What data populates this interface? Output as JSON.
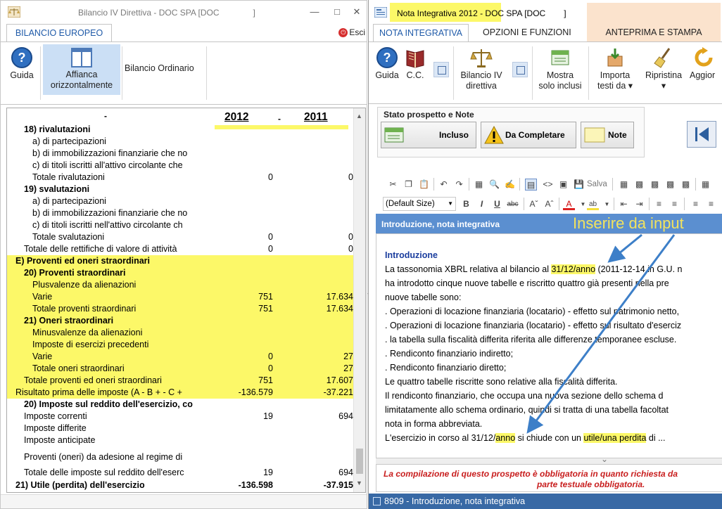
{
  "left_window": {
    "title": "Bilancio IV Direttiva - DOC SPA [DOC",
    "title_suffix": "]",
    "tab_label": "BILANCIO EUROPEO",
    "exit_label": "Esci",
    "ribbon": {
      "guida": "Guida",
      "affianca_line1": "Affianca",
      "affianca_line2": "orizzontalmente",
      "bilancio_ordinario": "Bilancio Ordinario"
    },
    "years": [
      "2012",
      "2011"
    ],
    "rows": [
      {
        "label": "18) rivalutazioni",
        "v1": "",
        "v2": ""
      },
      {
        "label": "a) di partecipazioni",
        "v1": "",
        "v2": ""
      },
      {
        "label": "b) di immobilizzazioni finanziarie che no",
        "v1": "",
        "v2": ""
      },
      {
        "label": "c) di titoli iscritti all'attivo circolante che",
        "v1": "",
        "v2": ""
      },
      {
        "label": "Totale rivalutazioni",
        "v1": "0",
        "v2": "0"
      },
      {
        "label": "19) svalutazioni",
        "v1": "",
        "v2": ""
      },
      {
        "label": "a) di partecipazioni",
        "v1": "",
        "v2": ""
      },
      {
        "label": "b) di immobilizzazioni finanziarie che no",
        "v1": "",
        "v2": ""
      },
      {
        "label": "c) di titoli iscritti nell'attivo circolante ch",
        "v1": "",
        "v2": ""
      },
      {
        "label": "Totale svalutazioni",
        "v1": "0",
        "v2": "0"
      },
      {
        "label": "Totale delle rettifiche di valore di attività",
        "v1": "0",
        "v2": "0"
      },
      {
        "label": "E) Proventi ed oneri straordinari",
        "v1": "",
        "v2": ""
      },
      {
        "label": "20) Proventi straordinari",
        "v1": "",
        "v2": ""
      },
      {
        "label": "Plusvalenze da alienazioni",
        "v1": "",
        "v2": ""
      },
      {
        "label": "Varie",
        "v1": "751",
        "v2": "17.634"
      },
      {
        "label": "Totale proventi straordinari",
        "v1": "751",
        "v2": "17.634"
      },
      {
        "label": "21) Oneri straordinari",
        "v1": "",
        "v2": ""
      },
      {
        "label": "Minusvalenze da alienazioni",
        "v1": "",
        "v2": ""
      },
      {
        "label": "Imposte di esercizi precedenti",
        "v1": "",
        "v2": ""
      },
      {
        "label": "Varie",
        "v1": "0",
        "v2": "27"
      },
      {
        "label": "Totale oneri straordinari",
        "v1": "0",
        "v2": "27"
      },
      {
        "label": "Totale proventi ed oneri straordinari",
        "v1": "751",
        "v2": "17.607"
      },
      {
        "label": "Risultato prima delle imposte (A - B + - C +",
        "v1": "-136.579",
        "v2": "-37.221"
      },
      {
        "label": "20) Imposte sul reddito dell'esercizio, co",
        "v1": "",
        "v2": ""
      },
      {
        "label": "Imposte correnti",
        "v1": "19",
        "v2": "694"
      },
      {
        "label": "Imposte differite",
        "v1": "",
        "v2": ""
      },
      {
        "label": "Imposte anticipate",
        "v1": "",
        "v2": ""
      },
      {
        "label": "Proventi (oneri) da adesione al regime di",
        "v1": "",
        "v2": ""
      },
      {
        "label": "Totale delle imposte sul reddito dell'eserc",
        "v1": "19",
        "v2": "694"
      },
      {
        "label": "21) Utile (perdita) dell'esercizio",
        "v1": "-136.598",
        "v2": "-37.915"
      }
    ]
  },
  "right_window": {
    "title": "Nota Integrativa 2012 - DOC SPA [DOC",
    "title_suffix": "]",
    "tabs": [
      "NOTA INTEGRATIVA",
      "OPZIONI E FUNZIONI",
      "ANTEPRIMA E STAMPA"
    ],
    "ribbon": {
      "guida": "Guida",
      "cc": "C.C.",
      "bilancio_line1": "Bilancio IV",
      "bilancio_line2": "direttiva",
      "mostra_line1": "Mostra",
      "mostra_line2": "solo inclusi",
      "importa_line1": "Importa",
      "importa_line2": "testi da",
      "ripristina": "Ripristina",
      "aggiorna": "Aggior"
    },
    "stato_label": "Stato prospetto e Note",
    "stato_buttons": [
      "Incluso",
      "Da Completare",
      "Note"
    ],
    "salva": "Salva",
    "font_size": "(Default Size)",
    "section_header": "Introduzione, nota integrativa",
    "callout": "Inserire da input",
    "editor": {
      "heading": "Introduzione",
      "lines": [
        {
          "pre": "La tassonomia XBRL relativa al bilancio al ",
          "mark": "31/12/anno",
          "post": " (2011-12-14 in G.U. n"
        },
        {
          "pre": "ha introdotto cinque nuove tabelle e riscritto quattro già presenti nella pre",
          "mark": "",
          "post": ""
        },
        {
          "pre": "nuove tabelle sono:",
          "mark": "",
          "post": ""
        },
        {
          "pre": ". Operazioni di locazione finanziaria (locatario) - effetto sul patrimonio netto,",
          "mark": "",
          "post": ""
        },
        {
          "pre": ". Operazioni di locazione finanziaria (locatario) - effetto sul risultato d'eserciz",
          "mark": "",
          "post": ""
        },
        {
          "pre": ". la tabella sulla fiscalità differita riferita alle differenze temporanee escluse.",
          "mark": "",
          "post": ""
        },
        {
          "pre": ". Rendiconto finanziario indiretto;",
          "mark": "",
          "post": ""
        },
        {
          "pre": ". Rendiconto finanziario diretto;",
          "mark": "",
          "post": ""
        },
        {
          "pre": "Le quattro tabelle riscritte sono relative alla fiscalità differita.",
          "mark": "",
          "post": ""
        },
        {
          "pre": "Il rendiconto finanziario, che occupa una nuova sezione dello schema d",
          "mark": "",
          "post": ""
        },
        {
          "pre": "limitatamente allo schema ordinario, quindi si tratta di una tabella facoltat",
          "mark": "",
          "post": ""
        },
        {
          "pre": "nota in forma abbreviata.",
          "mark": "",
          "post": ""
        },
        {
          "pre": "L'esercizio in corso al 31/12/",
          "mark": "anno",
          "post": " si chiude con un ",
          "mark2": "utile/una perdita",
          "post2": " di ..."
        }
      ]
    },
    "note_line1": "La compilazione di questo prospetto è obbligatoria in quanto richiesta da",
    "note_line2": "parte testuale obbligatoria.",
    "status": "8909 - Introduzione, nota integrativa"
  },
  "colors": {
    "highlight": "#fcf868",
    "accent_blue": "#5b8fd0",
    "status_blue": "#3869a5",
    "apricot_tab": "#fbe3cd",
    "note_red": "#c81e1e"
  }
}
